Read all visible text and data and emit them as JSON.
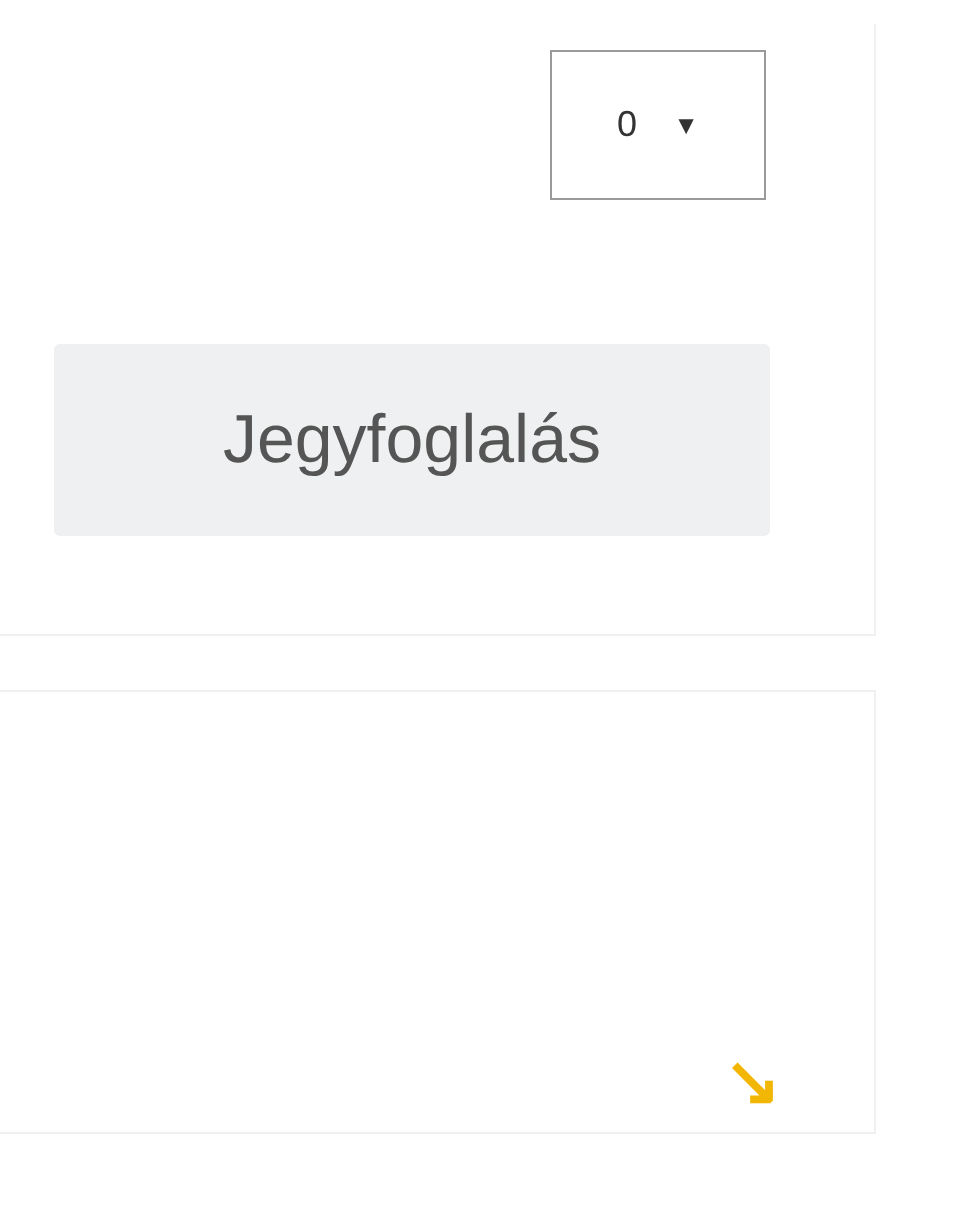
{
  "booking_card": {
    "quantity_select": {
      "value": "0",
      "caret": "▼"
    },
    "button": "Jegyfoglalás"
  },
  "link_card": {
    "arrow": "↘"
  }
}
